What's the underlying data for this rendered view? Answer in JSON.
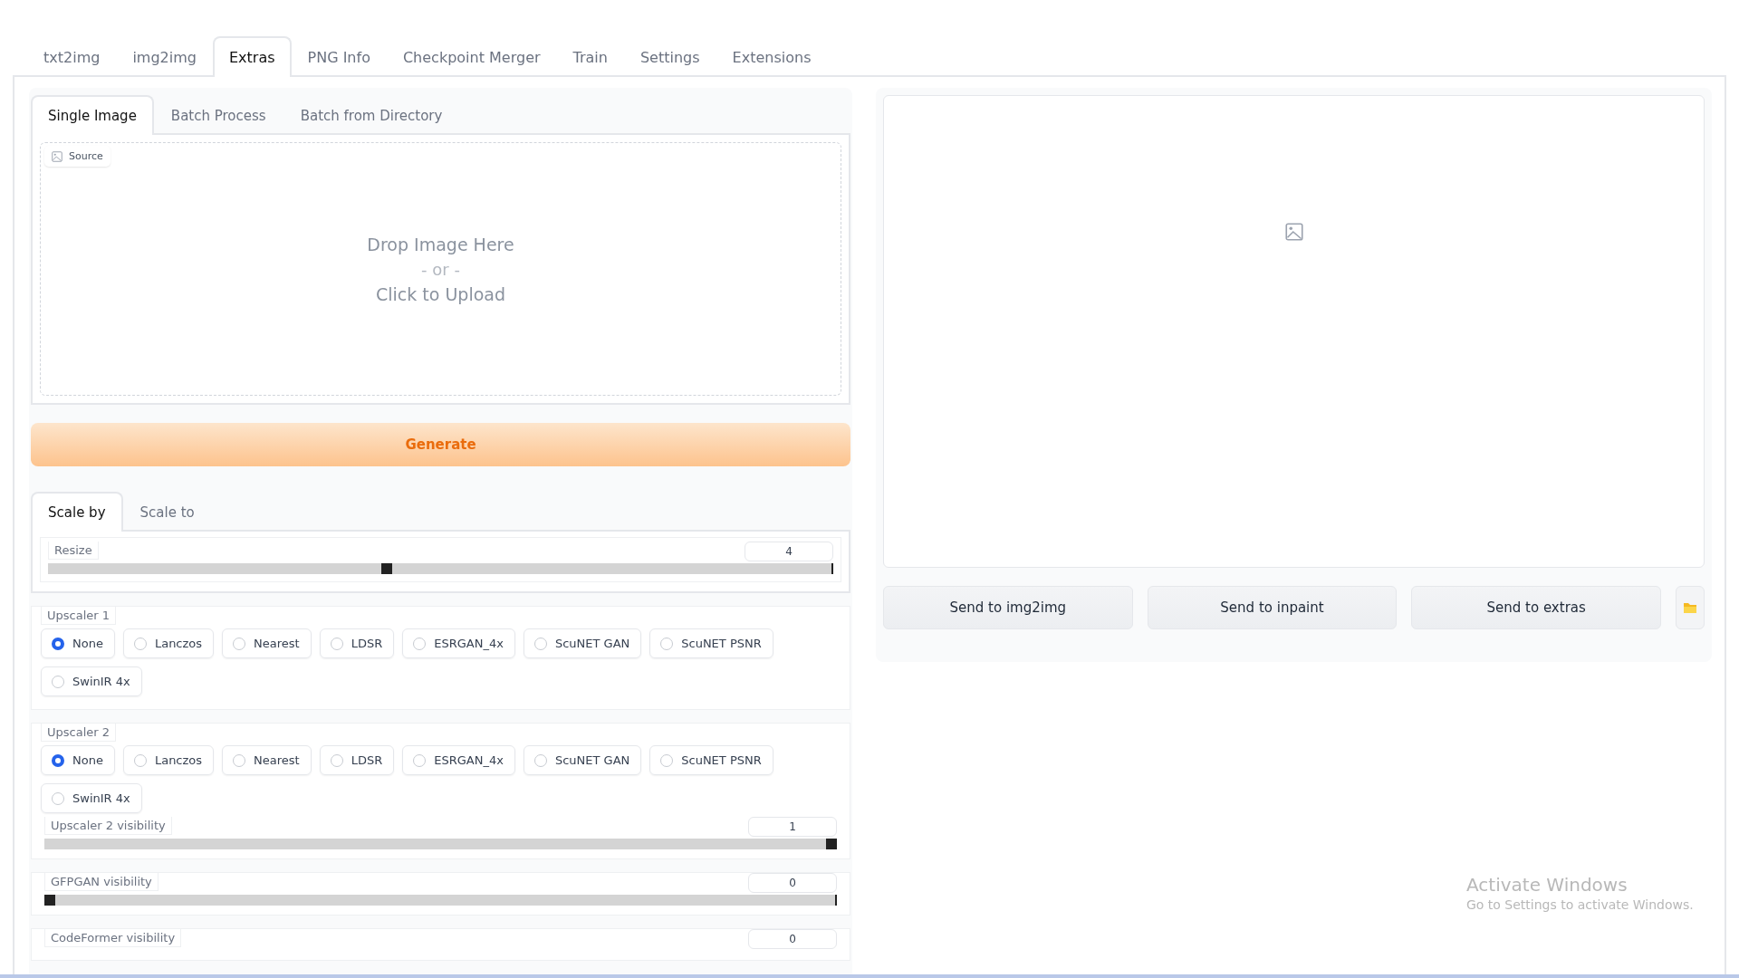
{
  "main_tabs": [
    {
      "label": "txt2img",
      "selected": false
    },
    {
      "label": "img2img",
      "selected": false
    },
    {
      "label": "Extras",
      "selected": true
    },
    {
      "label": "PNG Info",
      "selected": false
    },
    {
      "label": "Checkpoint Merger",
      "selected": false
    },
    {
      "label": "Train",
      "selected": false
    },
    {
      "label": "Settings",
      "selected": false
    },
    {
      "label": "Extensions",
      "selected": false
    }
  ],
  "left_panel": {
    "sub_tabs": [
      {
        "label": "Single Image",
        "selected": true
      },
      {
        "label": "Batch Process",
        "selected": false
      },
      {
        "label": "Batch from Directory",
        "selected": false
      }
    ],
    "source": {
      "label": "Source",
      "drop_text": "Drop Image Here",
      "or_text": "- or -",
      "upload_text": "Click to Upload"
    },
    "generate_button": "Generate",
    "scale_tabs": [
      {
        "label": "Scale by",
        "selected": true
      },
      {
        "label": "Scale to",
        "selected": false
      }
    ],
    "resize": {
      "label": "Resize",
      "value": "4",
      "level": 0.43
    },
    "upscalers": [
      {
        "label": "Upscaler 1",
        "options": [
          {
            "label": "None",
            "selected": true
          },
          {
            "label": "Lanczos",
            "selected": false
          },
          {
            "label": "Nearest",
            "selected": false
          },
          {
            "label": "LDSR",
            "selected": false
          },
          {
            "label": "ESRGAN_4x",
            "selected": false
          },
          {
            "label": "ScuNET GAN",
            "selected": false
          },
          {
            "label": "ScuNET PSNR",
            "selected": false
          },
          {
            "label": "SwinIR 4x",
            "selected": false
          }
        ]
      },
      {
        "label": "Upscaler 2",
        "options": [
          {
            "label": "None",
            "selected": true
          },
          {
            "label": "Lanczos",
            "selected": false
          },
          {
            "label": "Nearest",
            "selected": false
          },
          {
            "label": "LDSR",
            "selected": false
          },
          {
            "label": "ESRGAN_4x",
            "selected": false
          },
          {
            "label": "ScuNET GAN",
            "selected": false
          },
          {
            "label": "ScuNET PSNR",
            "selected": false
          },
          {
            "label": "SwinIR 4x",
            "selected": false
          }
        ],
        "slider": {
          "label": "Upscaler 2 visibility",
          "value": "1",
          "level": 1
        }
      }
    ],
    "sliders": [
      {
        "label": "GFPGAN visibility",
        "value": "0",
        "level": 0
      },
      {
        "label": "CodeFormer visibility",
        "value": "0"
      }
    ]
  },
  "right_panel": {
    "buttons": [
      "Send to img2img",
      "Send to inpaint",
      "Send to extras"
    ]
  },
  "os_notice": {
    "title": "Activate Windows",
    "text": "Go to Settings to activate Windows."
  }
}
